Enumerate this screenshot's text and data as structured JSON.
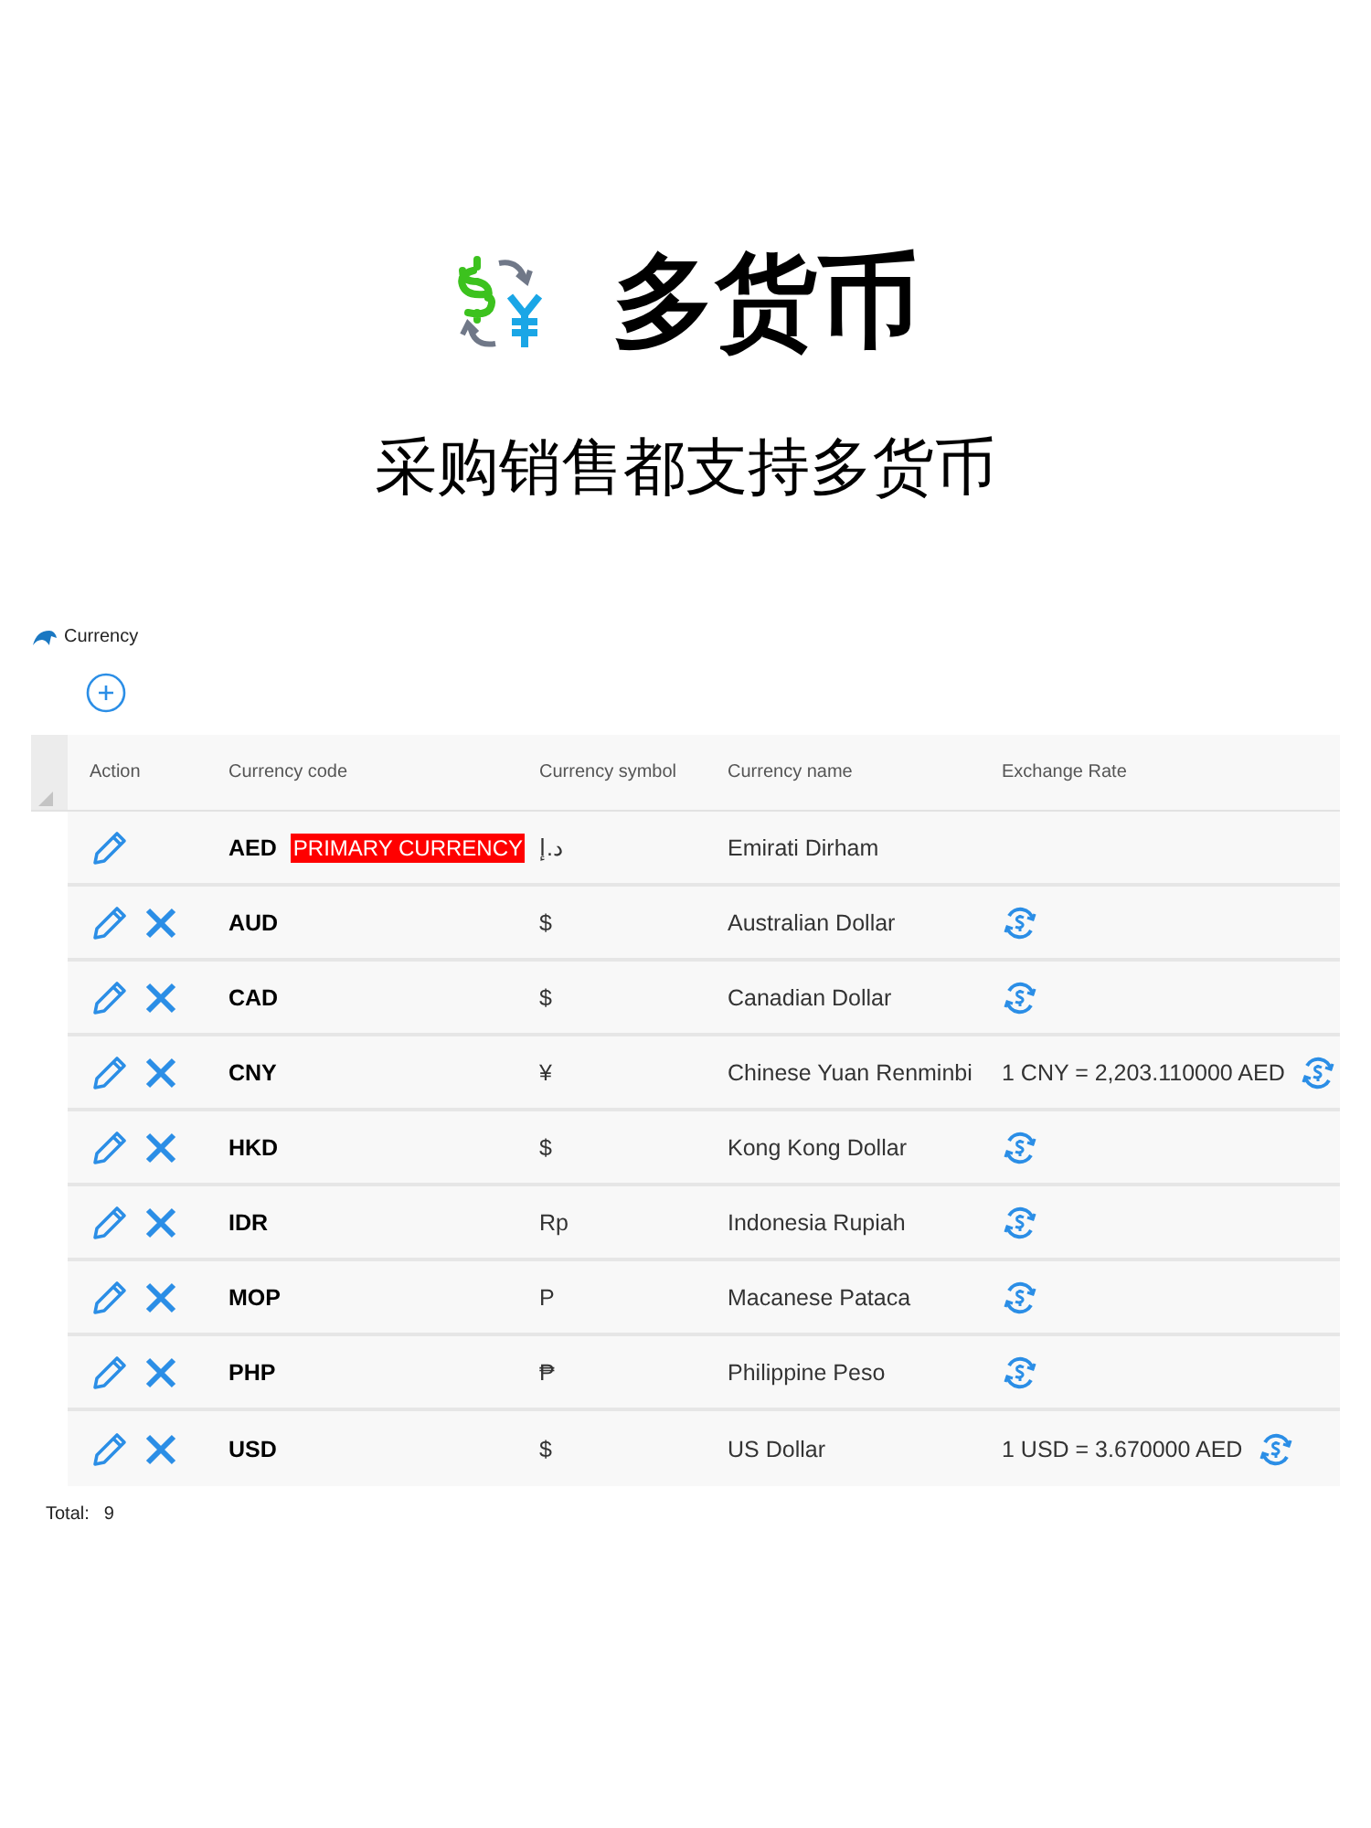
{
  "hero": {
    "title": "多货币",
    "subtitle": "采购销售都支持多货币"
  },
  "page": {
    "title": "Currency"
  },
  "table": {
    "columns": [
      "Action",
      "Currency code",
      "Currency symbol",
      "Currency name",
      "Exchange Rate"
    ],
    "rows": [
      {
        "code": "AED",
        "badge": "PRIMARY CURRENCY",
        "symbol": "د.إ",
        "name": "Emirati Dirham",
        "deletable": false,
        "rate_button": false
      },
      {
        "code": "AUD",
        "symbol": "$",
        "name": "Australian Dollar",
        "deletable": true,
        "rate_button": true
      },
      {
        "code": "CAD",
        "symbol": "$",
        "name": "Canadian Dollar",
        "deletable": true,
        "rate_button": true
      },
      {
        "code": "CNY",
        "symbol": "¥",
        "name": "Chinese Yuan Renminbi",
        "rate": "1 CNY = 2,203.110000 AED",
        "deletable": true,
        "rate_button": true
      },
      {
        "code": "HKD",
        "symbol": "$",
        "name": "Kong Kong Dollar",
        "deletable": true,
        "rate_button": true
      },
      {
        "code": "IDR",
        "symbol": "Rp",
        "name": "Indonesia Rupiah",
        "deletable": true,
        "rate_button": true
      },
      {
        "code": "MOP",
        "symbol": "P",
        "name": "Macanese Pataca",
        "deletable": true,
        "rate_button": true
      },
      {
        "code": "PHP",
        "symbol": "₱",
        "name": "Philippine Peso",
        "deletable": true,
        "rate_button": true
      },
      {
        "code": "USD",
        "symbol": "$",
        "name": "US Dollar",
        "rate": "1 USD = 3.670000 AED",
        "deletable": true,
        "rate_button": true
      }
    ]
  },
  "footer": {
    "total_label": "Total:",
    "total": "9"
  }
}
